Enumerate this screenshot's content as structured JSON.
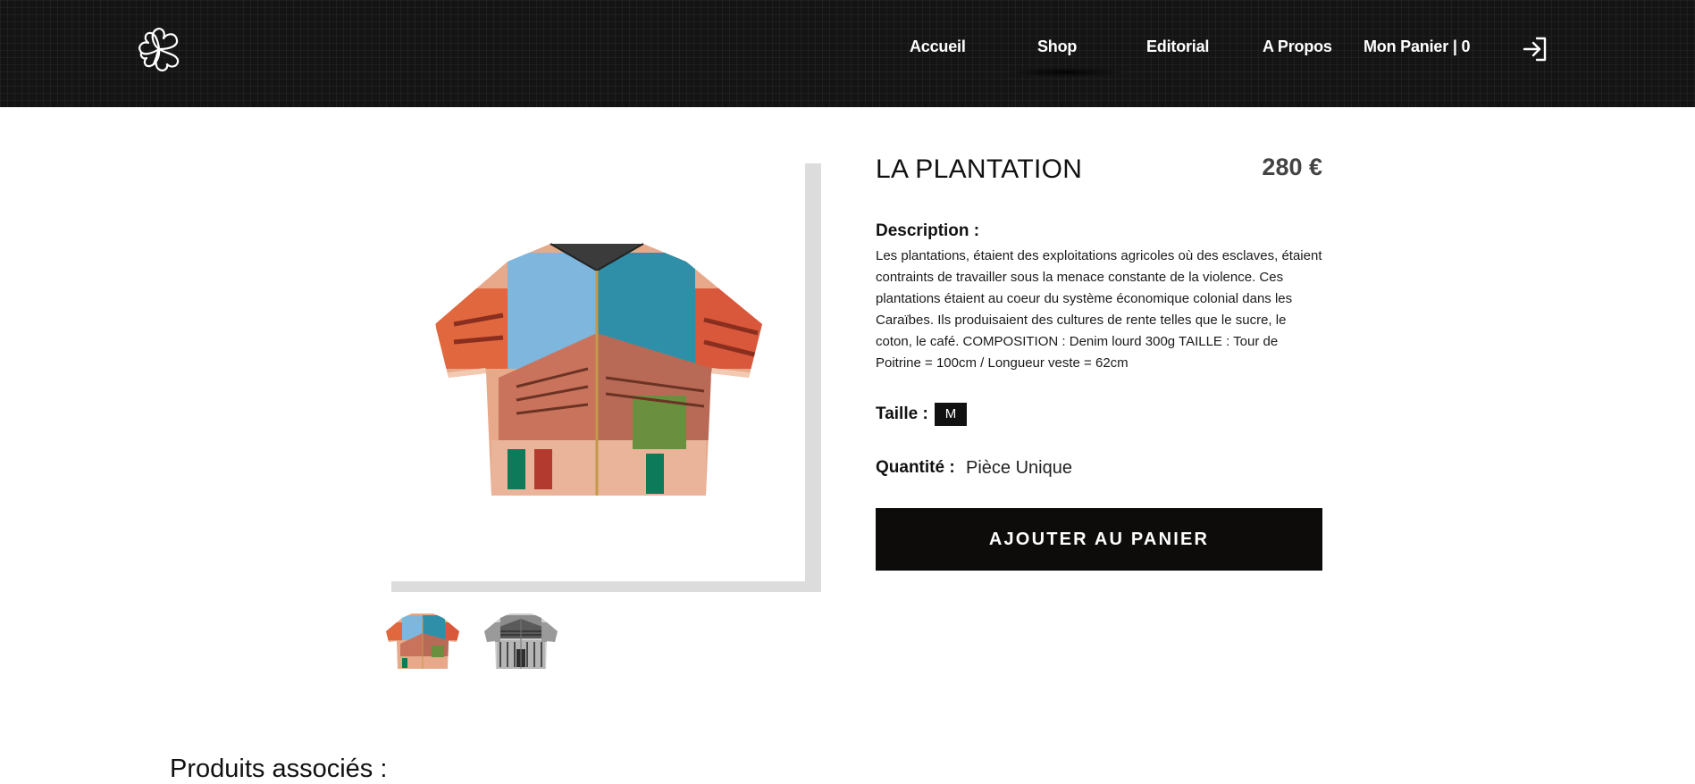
{
  "header": {
    "logo_icon": "four-petal-flower-logo-icon",
    "nav": {
      "home": "Accueil",
      "shop": "Shop",
      "editorial": "Editorial",
      "about": "A Propos",
      "cart": "Mon Panier | 0"
    },
    "active_nav": "Shop",
    "login_icon": "sign-in-arrow-icon"
  },
  "product": {
    "title": "LA PLANTATION",
    "price": "280 €",
    "description_label": "Description :",
    "description": "Les plantations, étaient des exploitations agricoles où des esclaves, étaient contraints de travailler sous la menace constante de la violence. Ces plantations étaient au coeur du système économique colonial dans les Caraïbes. Ils produisaient des cultures de rente telles que le sucre, le coton, le café. COMPOSITION : Denim lourd 300g TAILLE : Tour de Poitrine = 100cm / Longueur veste = 62cm",
    "size_label": "Taille :",
    "size_value": "M",
    "quantity_label": "Quantité :",
    "quantity_value": "Pièce Unique",
    "add_to_cart": "AJOUTER AU PANIER",
    "images": [
      "painted-zip-jacket-color",
      "painted-zip-jacket-grayscale"
    ]
  },
  "related": {
    "title": "Produits associés :"
  },
  "colors": {
    "header_bg": "#141414",
    "button_bg": "#0e0c0b",
    "frame_shadow": "#dcdcdc",
    "price": "#444444"
  }
}
